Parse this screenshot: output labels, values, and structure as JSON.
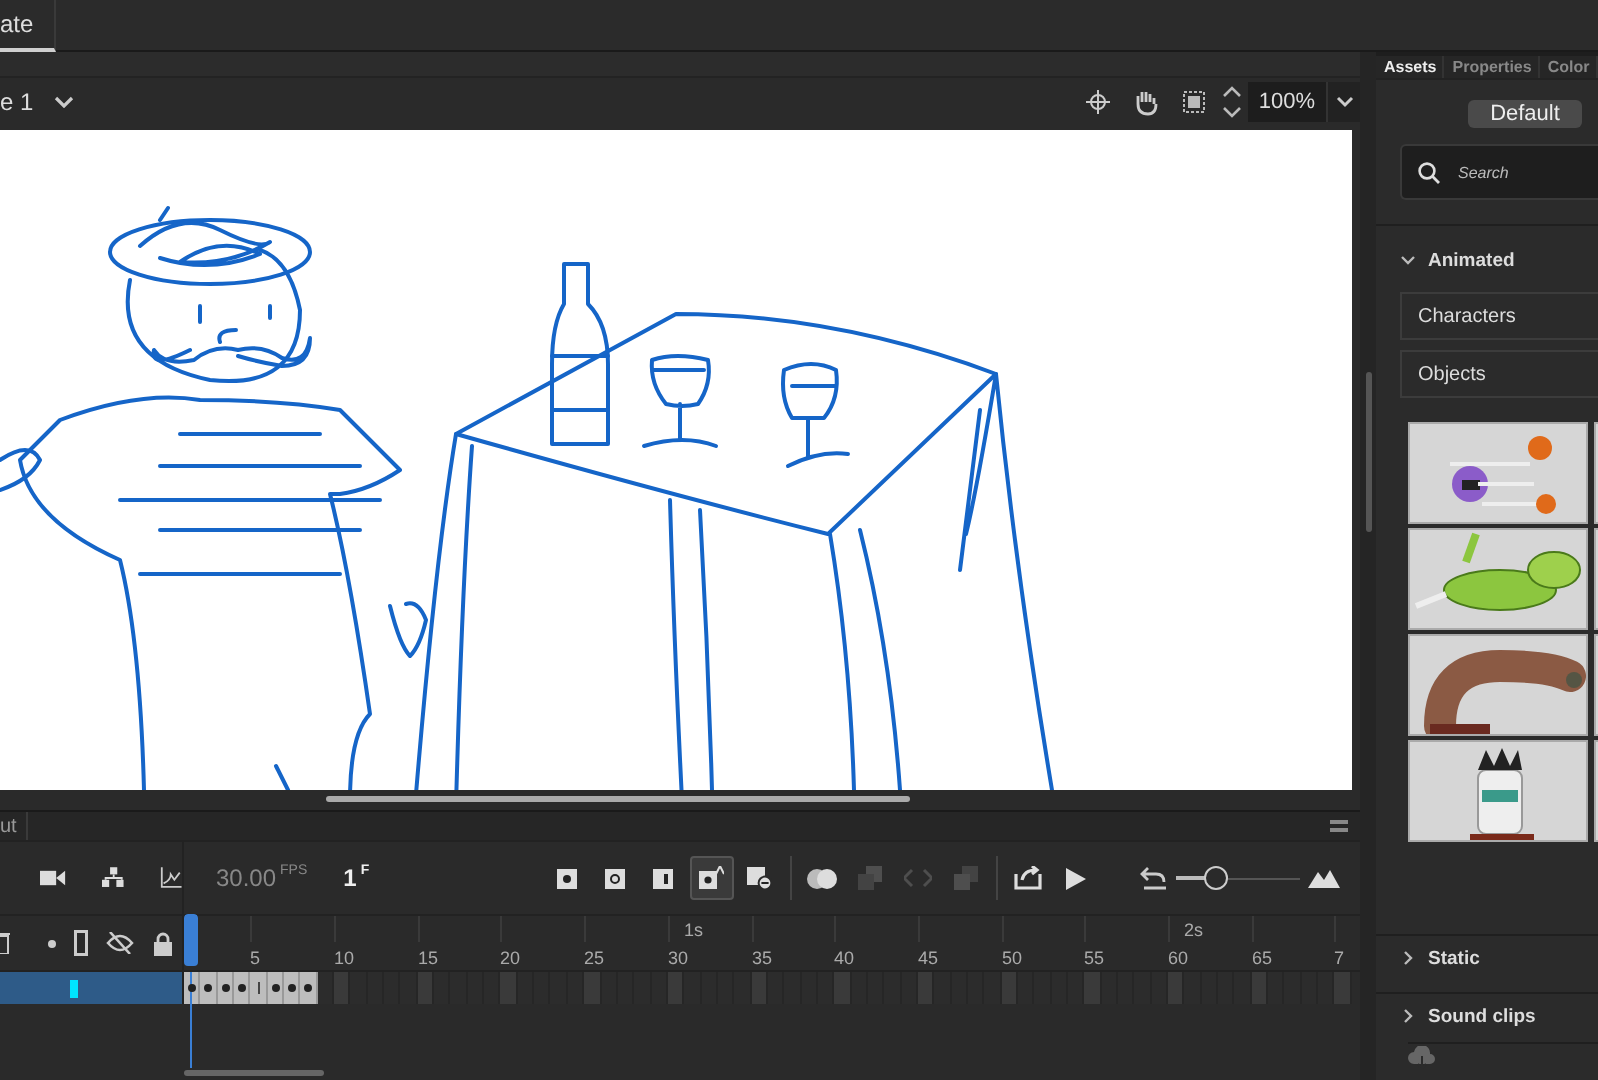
{
  "document_tab": {
    "label": "ate",
    "selected": true
  },
  "scene": {
    "label": "e 1"
  },
  "stage_tools": [
    {
      "kind": "center"
    },
    {
      "kind": "hand"
    },
    {
      "kind": "clip"
    }
  ],
  "zoom": {
    "value": "100%"
  },
  "panel_tabs": [
    {
      "label": "Assets",
      "selected": true
    },
    {
      "label": "Properties",
      "selected": false
    },
    {
      "label": "Color",
      "selected": false
    }
  ],
  "preset_button": "Default",
  "search": {
    "placeholder": "Search"
  },
  "categories": [
    {
      "label": "Animated",
      "expanded": true,
      "folders": [
        "Characters",
        "Objects"
      ],
      "thumbnails": [
        {
          "kind": "cats"
        },
        {
          "kind": "dinosaur"
        },
        {
          "kind": "worm"
        },
        {
          "kind": "mummy"
        }
      ]
    },
    {
      "label": "Static",
      "expanded": false
    },
    {
      "label": "Sound clips",
      "expanded": false
    }
  ],
  "timeline": {
    "panel_title": "ut",
    "fps": "30.00",
    "fps_unit": "FPS",
    "frame": "1",
    "frame_unit": "F",
    "tools": [
      {
        "kind": "keyframe",
        "selected": false,
        "disabled": false
      },
      {
        "kind": "blank-keyframe",
        "selected": false,
        "disabled": false
      },
      {
        "kind": "frame",
        "selected": false,
        "disabled": false
      },
      {
        "kind": "auto-keyframe",
        "selected": true,
        "disabled": false
      },
      {
        "kind": "remove-frame",
        "selected": false,
        "disabled": false
      },
      {
        "kind": "onion",
        "selected": false,
        "disabled": false
      },
      {
        "kind": "edit-multiple",
        "selected": false,
        "disabled": true
      },
      {
        "kind": "code",
        "selected": false,
        "disabled": true
      },
      {
        "kind": "paste",
        "selected": false,
        "disabled": true
      },
      {
        "kind": "export",
        "selected": false,
        "disabled": false
      },
      {
        "kind": "play",
        "selected": false,
        "disabled": false
      }
    ],
    "zoom_slider": {
      "level": 0.32
    },
    "seconds_markers": [
      "1s",
      "2s"
    ],
    "frame_numbers": [
      "5",
      "10",
      "15",
      "20",
      "25",
      "30",
      "35",
      "40",
      "45",
      "50",
      "55",
      "60",
      "65",
      "7"
    ],
    "layer": {
      "selected": true,
      "color": "#00e5ff",
      "frames": [
        {
          "kind": "keyframe"
        },
        {
          "kind": "keyframe"
        },
        {
          "kind": "keyframe"
        },
        {
          "kind": "keyframe"
        },
        {
          "kind": "span-end"
        },
        {
          "kind": "keyframe"
        },
        {
          "kind": "keyframe"
        },
        {
          "kind": "keyframe"
        }
      ]
    }
  }
}
